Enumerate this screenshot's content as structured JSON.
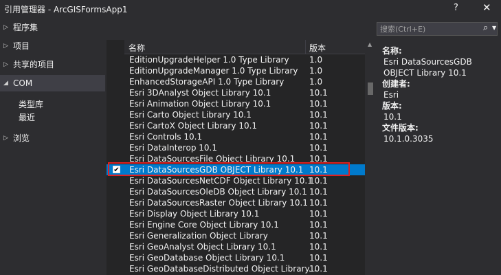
{
  "window": {
    "title": "引用管理器 - ArcGISFormsApp1",
    "help_glyph": "?",
    "close_glyph": "✕"
  },
  "sidebar": {
    "items": [
      {
        "label": "程序集",
        "expanded": false
      },
      {
        "label": "项目",
        "expanded": false
      },
      {
        "label": "共享的项目",
        "expanded": false
      },
      {
        "label": "COM",
        "expanded": true,
        "selected": true
      },
      {
        "label": "浏览",
        "expanded": false
      }
    ],
    "com_subitems": [
      {
        "label": "类型库"
      },
      {
        "label": "最近"
      }
    ]
  },
  "table": {
    "columns": {
      "name": "名称",
      "version": "版本"
    },
    "rows": [
      {
        "name": "EditionUpgradeHelper 1.0 Type Library",
        "version": "1.0",
        "checked": false
      },
      {
        "name": "EditionUpgradeManager 1.0 Type Library",
        "version": "1.0",
        "checked": false
      },
      {
        "name": "EnhancedStorageAPI 1.0 Type Library",
        "version": "1.0",
        "checked": false
      },
      {
        "name": "Esri 3DAnalyst Object Library 10.1",
        "version": "10.1",
        "checked": false
      },
      {
        "name": "Esri Animation Object Library 10.1",
        "version": "10.1",
        "checked": false
      },
      {
        "name": "Esri Carto Object Library 10.1",
        "version": "10.1",
        "checked": false
      },
      {
        "name": "Esri CartoX Object Library 10.1",
        "version": "10.1",
        "checked": false
      },
      {
        "name": "Esri Controls 10.1",
        "version": "10.1",
        "checked": false
      },
      {
        "name": "Esri DataInterop 10.1",
        "version": "10.1",
        "checked": false
      },
      {
        "name": "Esri DataSourcesFile Object Library 10.1",
        "version": "10.1",
        "checked": false
      },
      {
        "name": "Esri DataSourcesGDB OBJECT Library 10.1",
        "version": "10.1",
        "checked": true,
        "selected": true
      },
      {
        "name": "Esri DataSourcesNetCDF Object Library 10.1",
        "version": "10.1",
        "checked": false
      },
      {
        "name": "Esri DataSourcesOleDB Object Library 10.1",
        "version": "10.1",
        "checked": false
      },
      {
        "name": "Esri DataSourcesRaster Object Library 10.1",
        "version": "10.1",
        "checked": false
      },
      {
        "name": "Esri Display Object Library 10.1",
        "version": "10.1",
        "checked": false
      },
      {
        "name": "Esri Engine Core Object Library 10.1",
        "version": "10.1",
        "checked": false
      },
      {
        "name": "Esri Generalization Object Library",
        "version": "10.1",
        "checked": false
      },
      {
        "name": "Esri GeoAnalyst Object Library 10.1",
        "version": "10.1",
        "checked": false
      },
      {
        "name": "Esri GeoDatabase Object Library 10.1",
        "version": "10.1",
        "checked": false
      },
      {
        "name": "Esri GeoDatabaseDistributed Object Library...",
        "version": "10.1",
        "checked": false
      }
    ]
  },
  "search": {
    "placeholder": "搜索(Ctrl+E)",
    "value": ""
  },
  "details": {
    "name_label": "名称:",
    "name_value": "Esri DataSourcesGDB OBJECT Library 10.1",
    "creator_label": "创建者:",
    "creator_value": "Esri",
    "version_label": "版本:",
    "version_value": "10.1",
    "file_version_label": "文件版本:",
    "file_version_value": "10.1.0.3035"
  },
  "colors": {
    "background": "#2d2d30",
    "list_background": "#252526",
    "selection": "#007acc",
    "highlight_box": "#e02020"
  },
  "icons": {
    "search": "search-icon",
    "expand": "chevron-right-icon",
    "collapse": "chevron-down-icon",
    "close": "close-icon",
    "help": "help-icon"
  }
}
